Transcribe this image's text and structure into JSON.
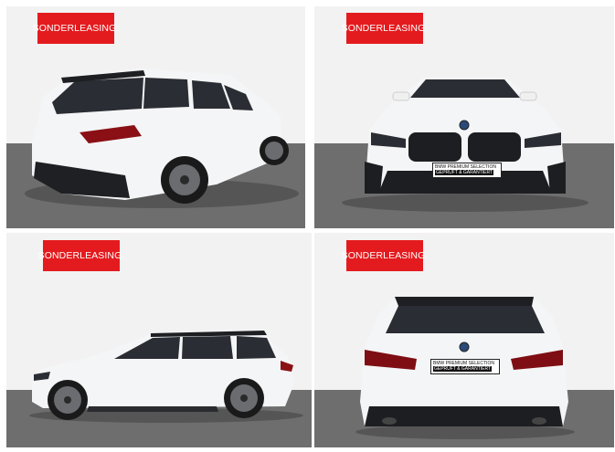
{
  "photos": [
    {
      "view": "rear-three-quarter",
      "badge": "SONDERLEASING."
    },
    {
      "view": "front",
      "badge": "SONDERLEASING.",
      "plate_line1": "BMW PREMIUM SELECTION",
      "plate_line2": "GEPRÜFT & GARANTIERT"
    },
    {
      "view": "side",
      "badge": "SONDERLEASING."
    },
    {
      "view": "rear",
      "badge": "SONDERLEASING.",
      "plate_line1": "BMW PREMIUM SELECTION",
      "plate_line2": "GEPRÜFT & GARANTIERT"
    }
  ],
  "colors": {
    "badge": "#e41b1e",
    "car_body": "#f4f5f6",
    "ground": "#6f6f6f",
    "glass": "#2a2d33"
  }
}
